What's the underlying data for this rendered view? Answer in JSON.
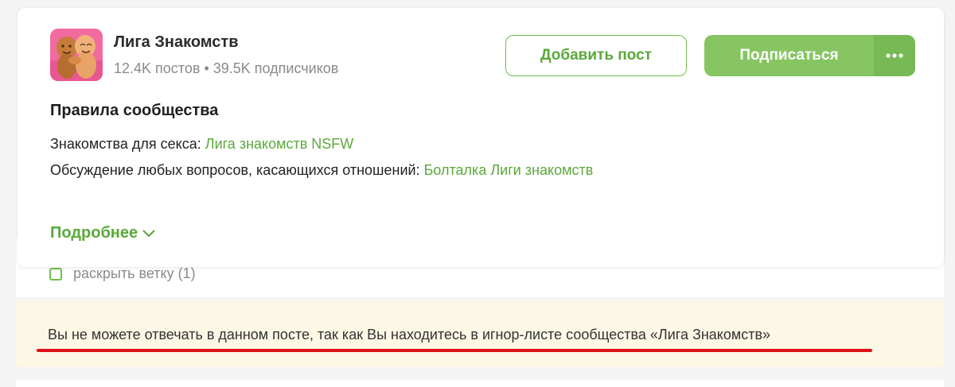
{
  "community": {
    "name": "Лига Знакомств",
    "posts": "12.4K постов",
    "separator": "•",
    "subscribers": "39.5K подписчиков",
    "add_post_label": "Добавить пост",
    "subscribe_label": "Подписаться",
    "more_icon": "more-dots-icon"
  },
  "rules": {
    "title": "Правила сообщества",
    "lines": [
      {
        "prefix": "Знакомства для секса: ",
        "link": "Лига знакомств NSFW"
      },
      {
        "prefix": "Обсуждение любых вопросов, касающихся отношений: ",
        "link": "Болталка Лиги знакомств"
      }
    ],
    "more_label": "Подробнее",
    "more_icon": "chevron-down-icon"
  },
  "comments": {
    "toggle_label": "раскрыть ветку (1)"
  },
  "notice": {
    "text": "Вы не можете отвечать в данном посте, так как Вы находитесь в игнор-листе сообщества «Лига Знакомств»"
  },
  "colors": {
    "accent": "#5aa93a",
    "subscribe_bg": "#86c562",
    "notice_bg": "#fdf7e5",
    "underline": "#e0101a"
  }
}
